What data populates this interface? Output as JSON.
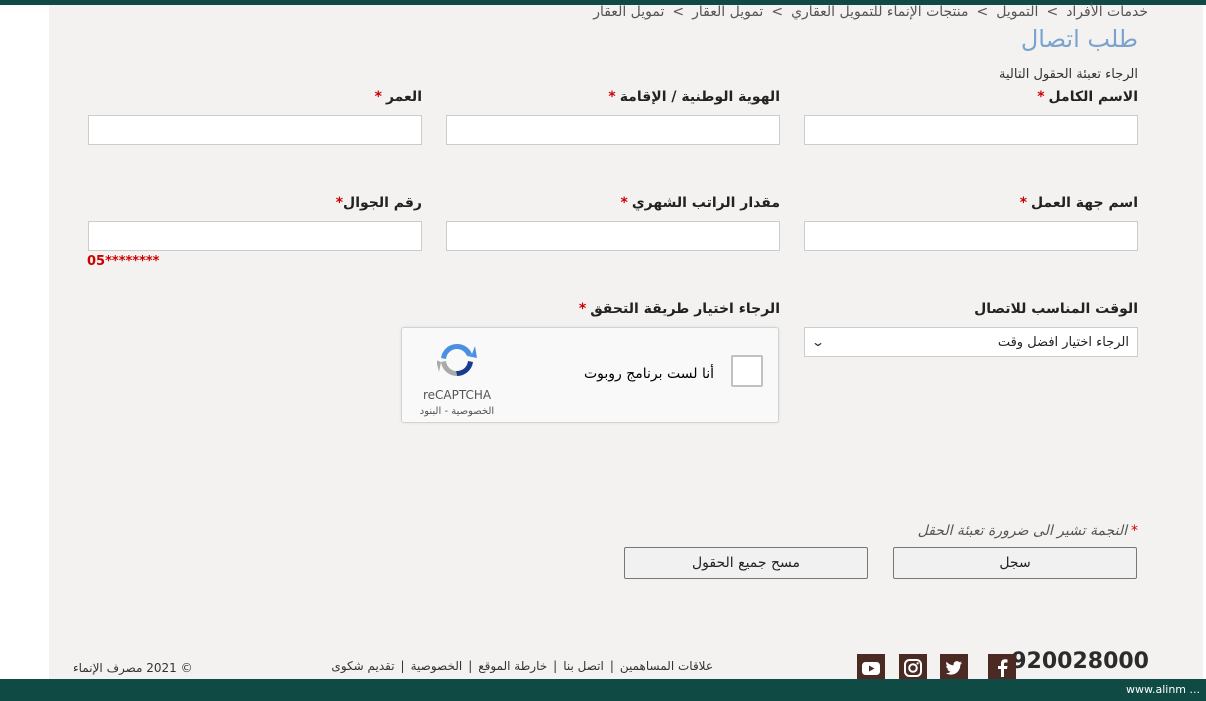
{
  "breadcrumb": [
    "خدمات الأفراد",
    "التمويل",
    "منتجات الإنماء للتمويل العقاري",
    "تمويل العقار",
    "تمويل العقار"
  ],
  "breadcrumb_sep": ">",
  "page_title": "طلب اتصال",
  "subtitle": "الرجاء تعبئة الحقول التالية",
  "required_mark": "*",
  "fields": {
    "full_name": {
      "label": "الاسم الكامل",
      "value": ""
    },
    "national_id": {
      "label": "الهوية الوطنية / الإقامة",
      "value": ""
    },
    "age": {
      "label": "العمر",
      "value": ""
    },
    "employer": {
      "label": "اسم جهة العمل",
      "value": ""
    },
    "salary": {
      "label": "مقدار الراتب الشهري",
      "value": ""
    },
    "mobile": {
      "label": "رقم الجوال",
      "value": "",
      "hint": "05********"
    }
  },
  "contact_time": {
    "label": "الوقت المناسب للاتصال",
    "selected": "الرجاء اختيار افضل وقت"
  },
  "verification": {
    "label": "الرجاء اختيار طريقة التحقق"
  },
  "recaptcha": {
    "checkbox_text": "أنا لست برنامج روبوت",
    "brand": "reCAPTCHA",
    "links": "الخصوصية - البنود"
  },
  "required_note": "النجمة تشير الى ضرورة تعبئة الحقل",
  "buttons": {
    "submit": "سجل",
    "clear": "مسح جميع الحقول"
  },
  "footer": {
    "links": [
      "علاقات المساهمين",
      "اتصل بنا",
      "خارطة الموقع",
      "الخصوصية",
      "تقديم شكوى"
    ],
    "copyright": "© 2021 مصرف الإنماء",
    "phone": "920028000",
    "social_icons": [
      "facebook-icon",
      "twitter-icon",
      "instagram-icon",
      "youtube-icon"
    ]
  },
  "status_url": "www.alinm ...",
  "colors": {
    "accent": "#0f4a44",
    "title": "#7ba3cf",
    "required": "#cc0000",
    "social": "#4a2a22"
  }
}
